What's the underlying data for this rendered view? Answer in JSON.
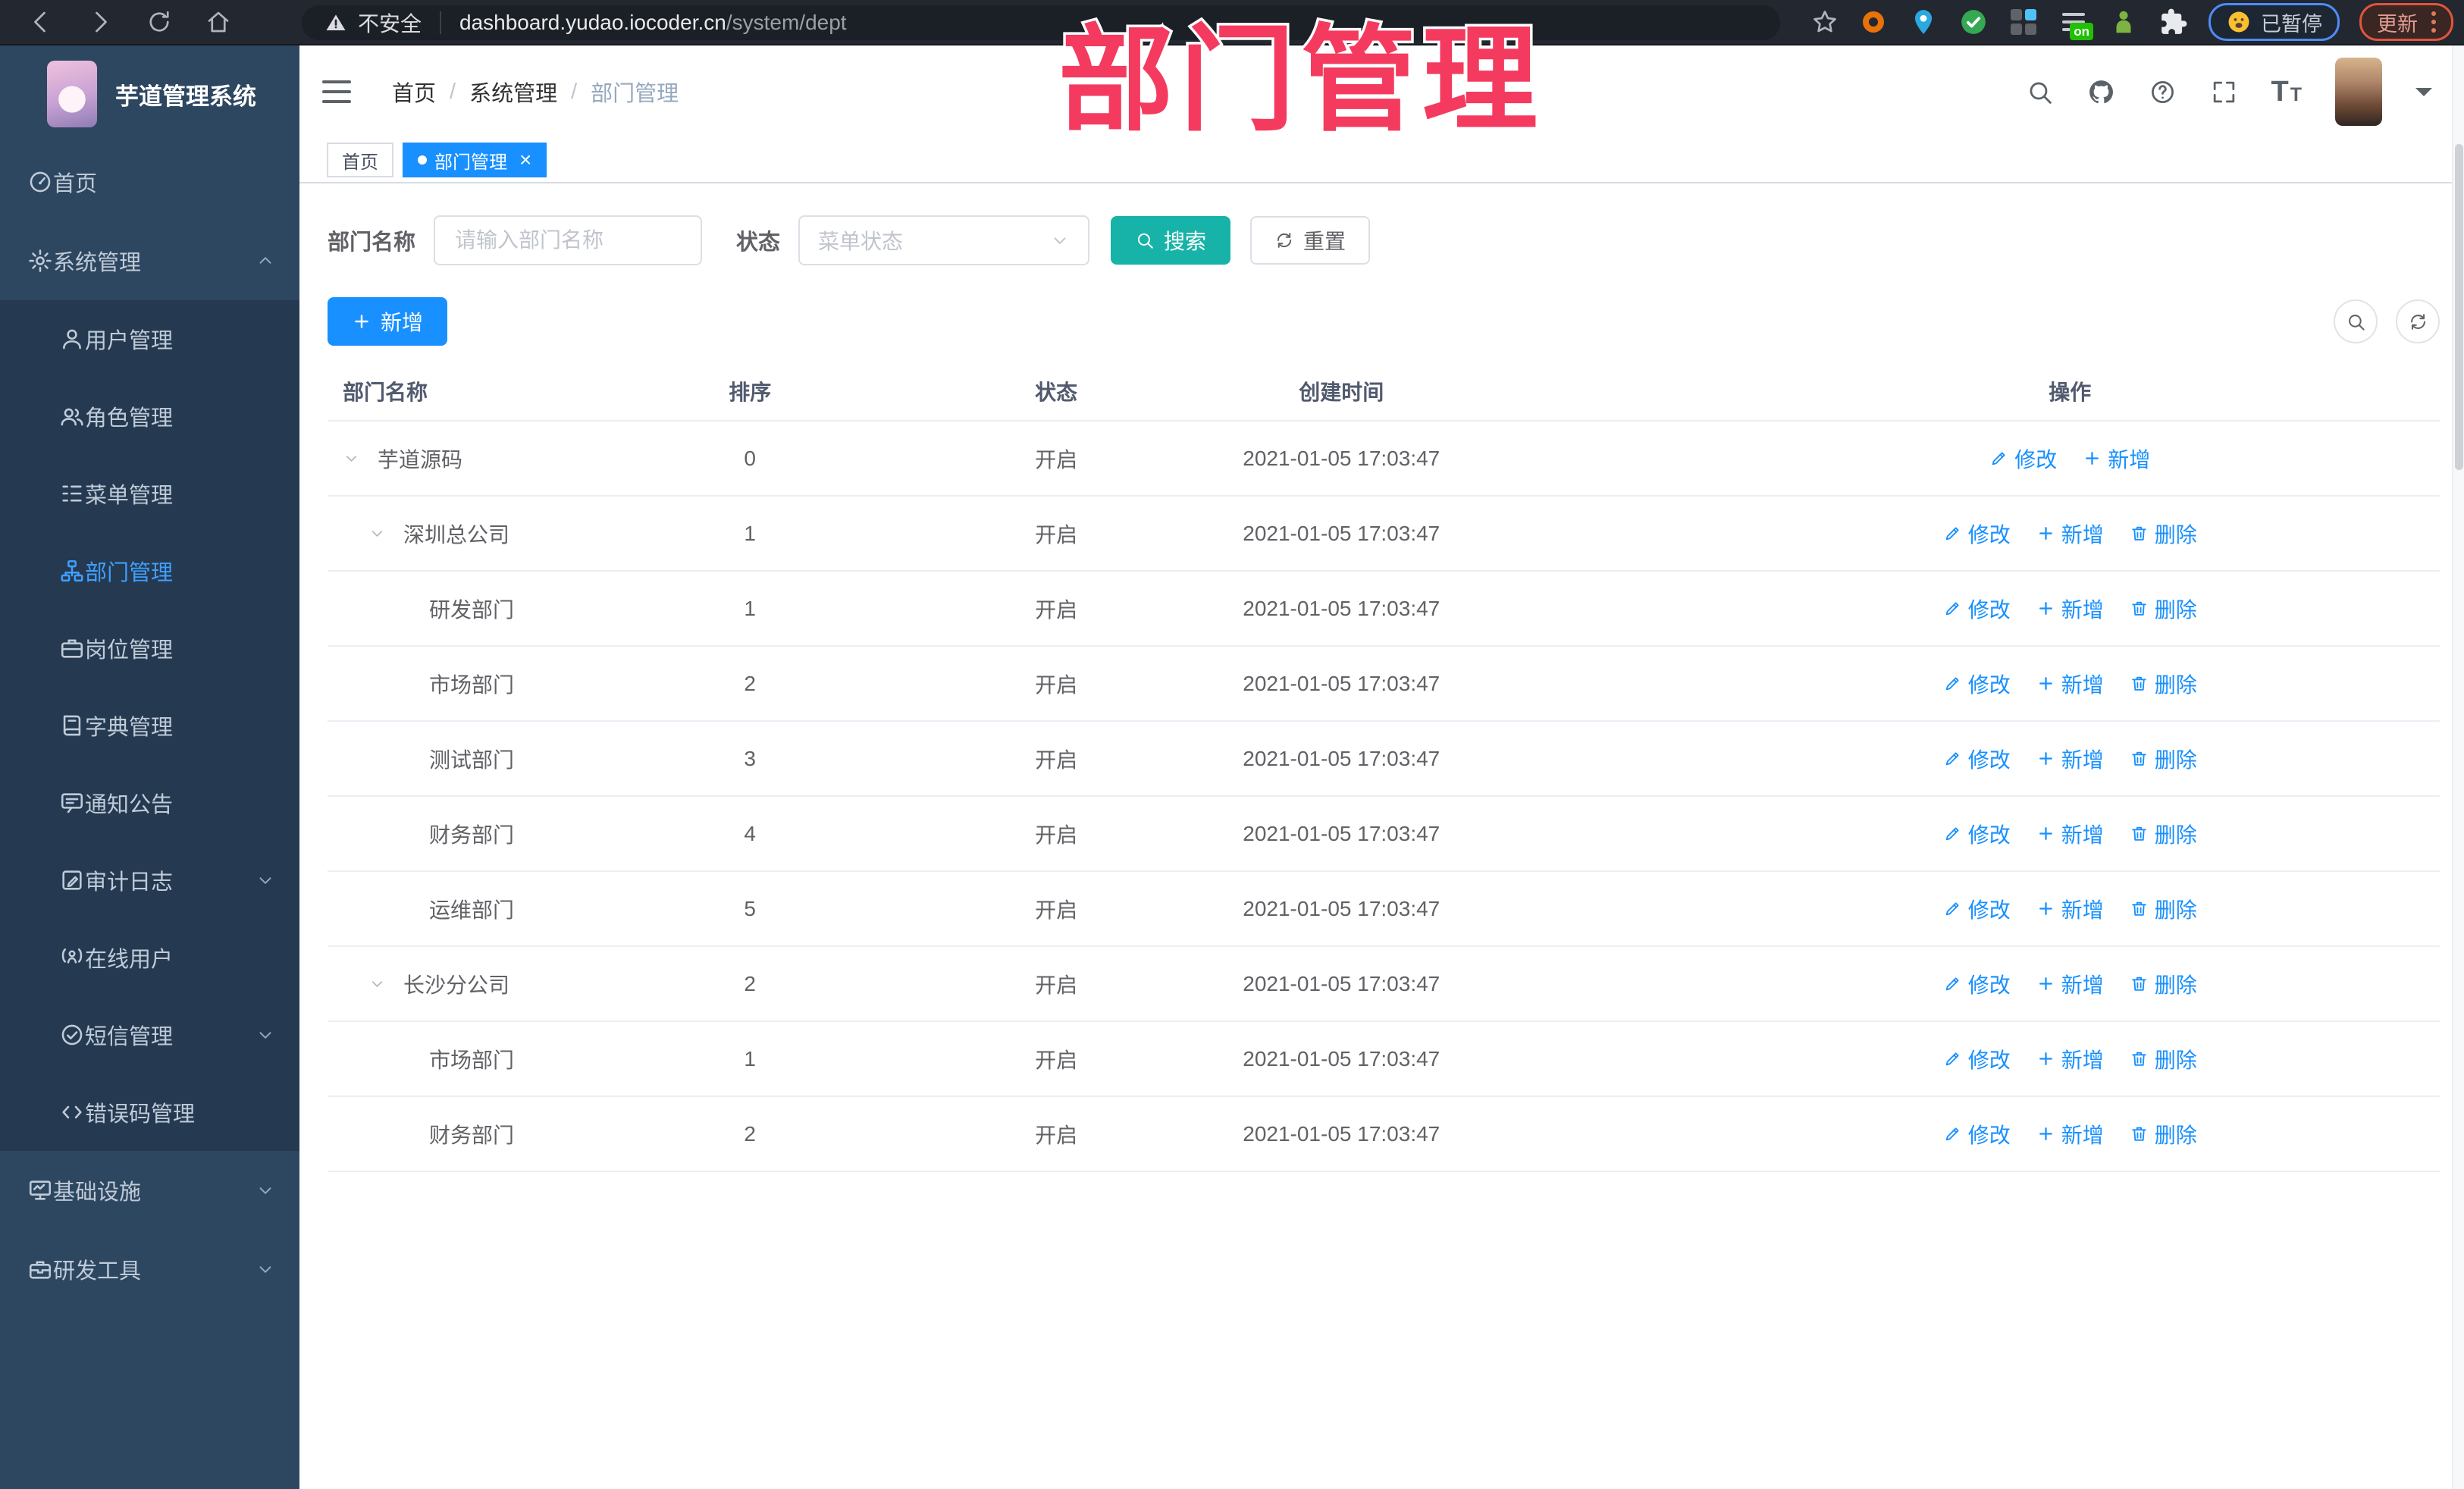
{
  "annotation": {
    "text": "部门管理",
    "color": "#f43b5f"
  },
  "browser": {
    "nav_icons": [
      "back-icon",
      "forward-icon",
      "reload-icon",
      "home-icon"
    ],
    "security_label": "不安全",
    "security_icon": "warning-icon",
    "url_host": "dashboard.yudao.iocoder.cn",
    "url_path": "/system/dept",
    "bookmark_icon": "star-icon",
    "extensions": [
      {
        "name": "extension-orange-ring-icon",
        "kind": "ring",
        "color": "#e8710a"
      },
      {
        "name": "extension-blue-pin-icon",
        "kind": "pin",
        "color": "#2aa8e0"
      },
      {
        "name": "extension-green-check-icon",
        "kind": "check",
        "color": "#34a853"
      },
      {
        "name": "extension-grid-icon",
        "kind": "grid",
        "color": "#4fc3f7"
      },
      {
        "name": "extension-list-on-icon",
        "kind": "list-on",
        "color": "#21c004",
        "badge": "on"
      },
      {
        "name": "extension-green-figure-icon",
        "kind": "figure",
        "color": "#7cb342"
      },
      {
        "name": "extension-puzzle-icon",
        "kind": "puzzle",
        "color": "#e8eaed"
      }
    ],
    "paused_badge": {
      "label": "已暂停",
      "icon": "emoji-face-icon"
    },
    "update_button": {
      "label": "更新",
      "menu_icon": "kebab-menu-icon"
    }
  },
  "sidebar": {
    "app_title": "芋道管理系统",
    "logo_icon": "app-logo",
    "items": [
      {
        "key": "home",
        "label": "首页",
        "icon": "dashboard-icon",
        "level": "top"
      },
      {
        "key": "system",
        "label": "系统管理",
        "icon": "gear-icon",
        "level": "top",
        "arrow": "up",
        "expanded": true
      },
      {
        "key": "user",
        "label": "用户管理",
        "icon": "user-icon",
        "level": "sub"
      },
      {
        "key": "role",
        "label": "角色管理",
        "icon": "users-icon",
        "level": "sub"
      },
      {
        "key": "menu",
        "label": "菜单管理",
        "icon": "menu-tree-icon",
        "level": "sub"
      },
      {
        "key": "dept",
        "label": "部门管理",
        "icon": "org-tree-icon",
        "level": "sub",
        "active": true
      },
      {
        "key": "post",
        "label": "岗位管理",
        "icon": "briefcase-icon",
        "level": "sub"
      },
      {
        "key": "dict",
        "label": "字典管理",
        "icon": "book-icon",
        "level": "sub"
      },
      {
        "key": "notice",
        "label": "通知公告",
        "icon": "message-icon",
        "level": "sub"
      },
      {
        "key": "audit-log",
        "label": "审计日志",
        "icon": "edit-log-icon",
        "level": "sub",
        "arrow": "down"
      },
      {
        "key": "online-user",
        "label": "在线用户",
        "icon": "online-user-icon",
        "level": "sub"
      },
      {
        "key": "sms",
        "label": "短信管理",
        "icon": "check-circle-icon",
        "level": "sub",
        "arrow": "down"
      },
      {
        "key": "error-code",
        "label": "错误码管理",
        "icon": "code-icon",
        "level": "sub"
      },
      {
        "key": "infra",
        "label": "基础设施",
        "icon": "monitor-icon",
        "level": "top",
        "arrow": "down"
      },
      {
        "key": "dev-tools",
        "label": "研发工具",
        "icon": "toolbox-icon",
        "level": "top",
        "arrow": "down"
      }
    ]
  },
  "header": {
    "menu_toggle_icon": "hamburger-icon",
    "breadcrumb": [
      "首页",
      "系统管理",
      "部门管理"
    ],
    "icons": [
      {
        "name": "search-icon"
      },
      {
        "name": "github-icon"
      },
      {
        "name": "help-icon"
      },
      {
        "name": "fullscreen-icon"
      },
      {
        "name": "font-size-icon",
        "glyph": "T"
      }
    ],
    "avatar": "user-avatar",
    "caret_icon": "caret-down-icon"
  },
  "tabs": [
    {
      "label": "首页",
      "active": false
    },
    {
      "label": "部门管理",
      "active": true,
      "closable": true,
      "close_icon": "close-icon"
    }
  ],
  "filters": {
    "name_label": "部门名称",
    "name_placeholder": "请输入部门名称",
    "status_label": "状态",
    "status_placeholder": "菜单状态",
    "search_button": "搜索",
    "reset_button": "重置"
  },
  "toolbar": {
    "add_button": "新增",
    "mini_buttons": [
      {
        "name": "hide-search-button",
        "icon": "search-icon"
      },
      {
        "name": "refresh-button",
        "icon": "refresh-icon"
      }
    ]
  },
  "table": {
    "columns": [
      "部门名称",
      "排序",
      "状态",
      "创建时间",
      "操作"
    ],
    "rows": [
      {
        "name": "芋道源码",
        "level": 1,
        "expanded": true,
        "sort": "0",
        "status": "开启",
        "created": "2021-01-05 17:03:47",
        "actions": [
          {
            "label": "修改",
            "icon": "edit-icon"
          },
          {
            "label": "新增",
            "icon": "plus-icon"
          }
        ]
      },
      {
        "name": "深圳总公司",
        "level": 2,
        "expanded": true,
        "sort": "1",
        "status": "开启",
        "created": "2021-01-05 17:03:47",
        "actions": [
          {
            "label": "修改",
            "icon": "edit-icon"
          },
          {
            "label": "新增",
            "icon": "plus-icon"
          },
          {
            "label": "删除",
            "icon": "delete-icon"
          }
        ]
      },
      {
        "name": "研发部门",
        "level": 3,
        "sort": "1",
        "status": "开启",
        "created": "2021-01-05 17:03:47",
        "actions": [
          {
            "label": "修改",
            "icon": "edit-icon"
          },
          {
            "label": "新增",
            "icon": "plus-icon"
          },
          {
            "label": "删除",
            "icon": "delete-icon"
          }
        ]
      },
      {
        "name": "市场部门",
        "level": 3,
        "sort": "2",
        "status": "开启",
        "created": "2021-01-05 17:03:47",
        "actions": [
          {
            "label": "修改",
            "icon": "edit-icon"
          },
          {
            "label": "新增",
            "icon": "plus-icon"
          },
          {
            "label": "删除",
            "icon": "delete-icon"
          }
        ]
      },
      {
        "name": "测试部门",
        "level": 3,
        "sort": "3",
        "status": "开启",
        "created": "2021-01-05 17:03:47",
        "actions": [
          {
            "label": "修改",
            "icon": "edit-icon"
          },
          {
            "label": "新增",
            "icon": "plus-icon"
          },
          {
            "label": "删除",
            "icon": "delete-icon"
          }
        ]
      },
      {
        "name": "财务部门",
        "level": 3,
        "sort": "4",
        "status": "开启",
        "created": "2021-01-05 17:03:47",
        "actions": [
          {
            "label": "修改",
            "icon": "edit-icon"
          },
          {
            "label": "新增",
            "icon": "plus-icon"
          },
          {
            "label": "删除",
            "icon": "delete-icon"
          }
        ]
      },
      {
        "name": "运维部门",
        "level": 3,
        "sort": "5",
        "status": "开启",
        "created": "2021-01-05 17:03:47",
        "actions": [
          {
            "label": "修改",
            "icon": "edit-icon"
          },
          {
            "label": "新增",
            "icon": "plus-icon"
          },
          {
            "label": "删除",
            "icon": "delete-icon"
          }
        ]
      },
      {
        "name": "长沙分公司",
        "level": 2,
        "expanded": true,
        "sort": "2",
        "status": "开启",
        "created": "2021-01-05 17:03:47",
        "actions": [
          {
            "label": "修改",
            "icon": "edit-icon"
          },
          {
            "label": "新增",
            "icon": "plus-icon"
          },
          {
            "label": "删除",
            "icon": "delete-icon"
          }
        ]
      },
      {
        "name": "市场部门",
        "level": 3,
        "sort": "1",
        "status": "开启",
        "created": "2021-01-05 17:03:47",
        "actions": [
          {
            "label": "修改",
            "icon": "edit-icon"
          },
          {
            "label": "新增",
            "icon": "plus-icon"
          },
          {
            "label": "删除",
            "icon": "delete-icon"
          }
        ]
      },
      {
        "name": "财务部门",
        "level": 3,
        "sort": "2",
        "status": "开启",
        "created": "2021-01-05 17:03:47",
        "actions": [
          {
            "label": "修改",
            "icon": "edit-icon"
          },
          {
            "label": "新增",
            "icon": "plus-icon"
          },
          {
            "label": "删除",
            "icon": "delete-icon"
          }
        ]
      }
    ]
  }
}
